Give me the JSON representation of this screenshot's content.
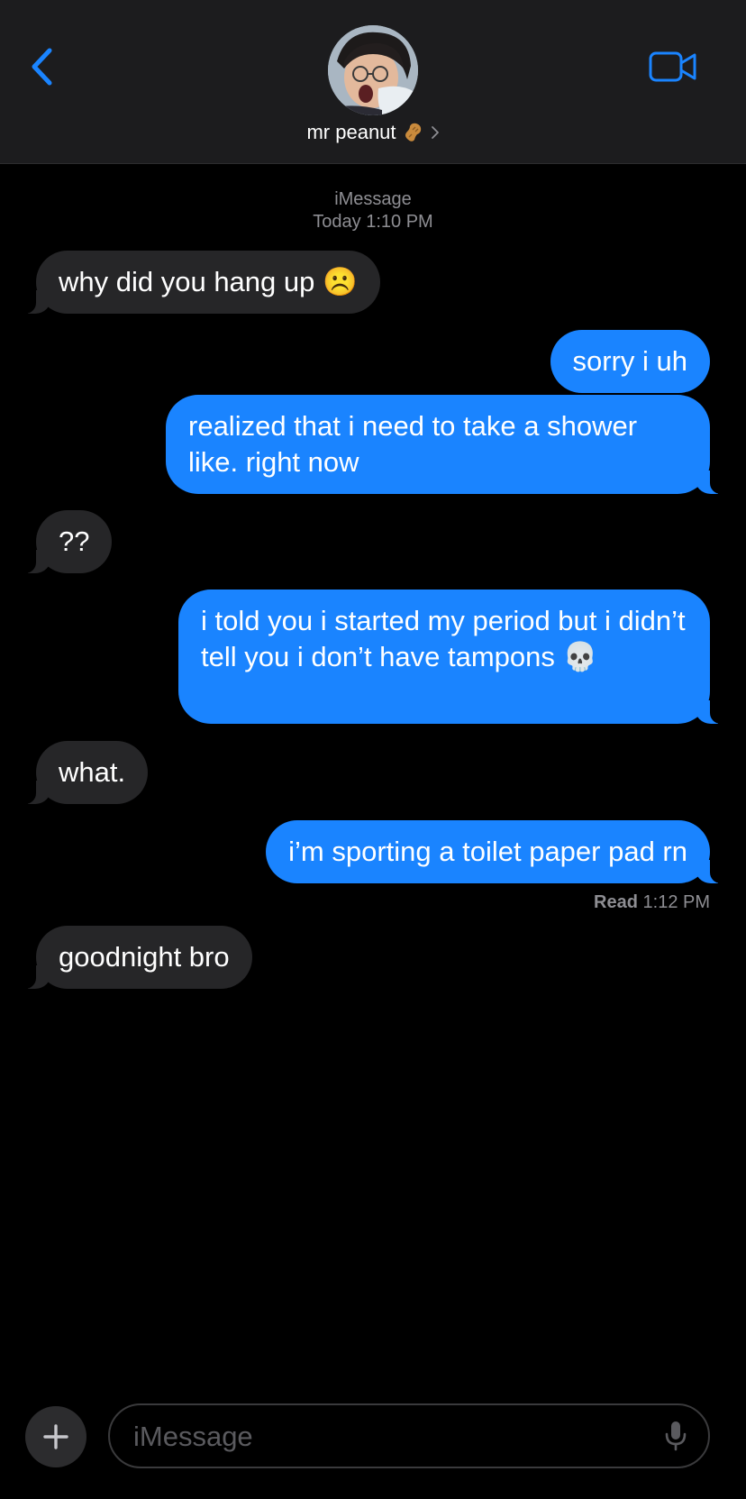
{
  "header": {
    "back_icon": "chevron-left-icon",
    "contact_name": "mr peanut",
    "contact_emoji": "peanut-emoji",
    "disclosure_icon": "chevron-right-icon",
    "video_icon": "video-camera-icon",
    "accent_color": "#1a84ff"
  },
  "conversation": {
    "service": "iMessage",
    "timestamp": "Today 1:10 PM",
    "messages": [
      {
        "from": "them",
        "text": "why did you hang up ☹️"
      },
      {
        "from": "me",
        "text": "sorry i uh"
      },
      {
        "from": "me",
        "text": "realized that i need to take a shower like. right now"
      },
      {
        "from": "them",
        "text": "??"
      },
      {
        "from": "me",
        "text": "i told you i started my period but i didn’t tell you i don’t have tampons 💀"
      },
      {
        "from": "them",
        "text": "what."
      },
      {
        "from": "me",
        "text": "i’m sporting a toilet paper pad rn"
      },
      {
        "from": "them",
        "text": "goodnight bro"
      }
    ],
    "read_label": "Read",
    "read_time": "1:12 PM"
  },
  "compose": {
    "plus_icon": "plus-icon",
    "placeholder": "iMessage",
    "mic_icon": "microphone-icon"
  },
  "colors": {
    "incoming_bubble": "#262628",
    "outgoing_bubble": "#1a84ff",
    "background": "#000000",
    "header_background": "#1c1c1e"
  }
}
